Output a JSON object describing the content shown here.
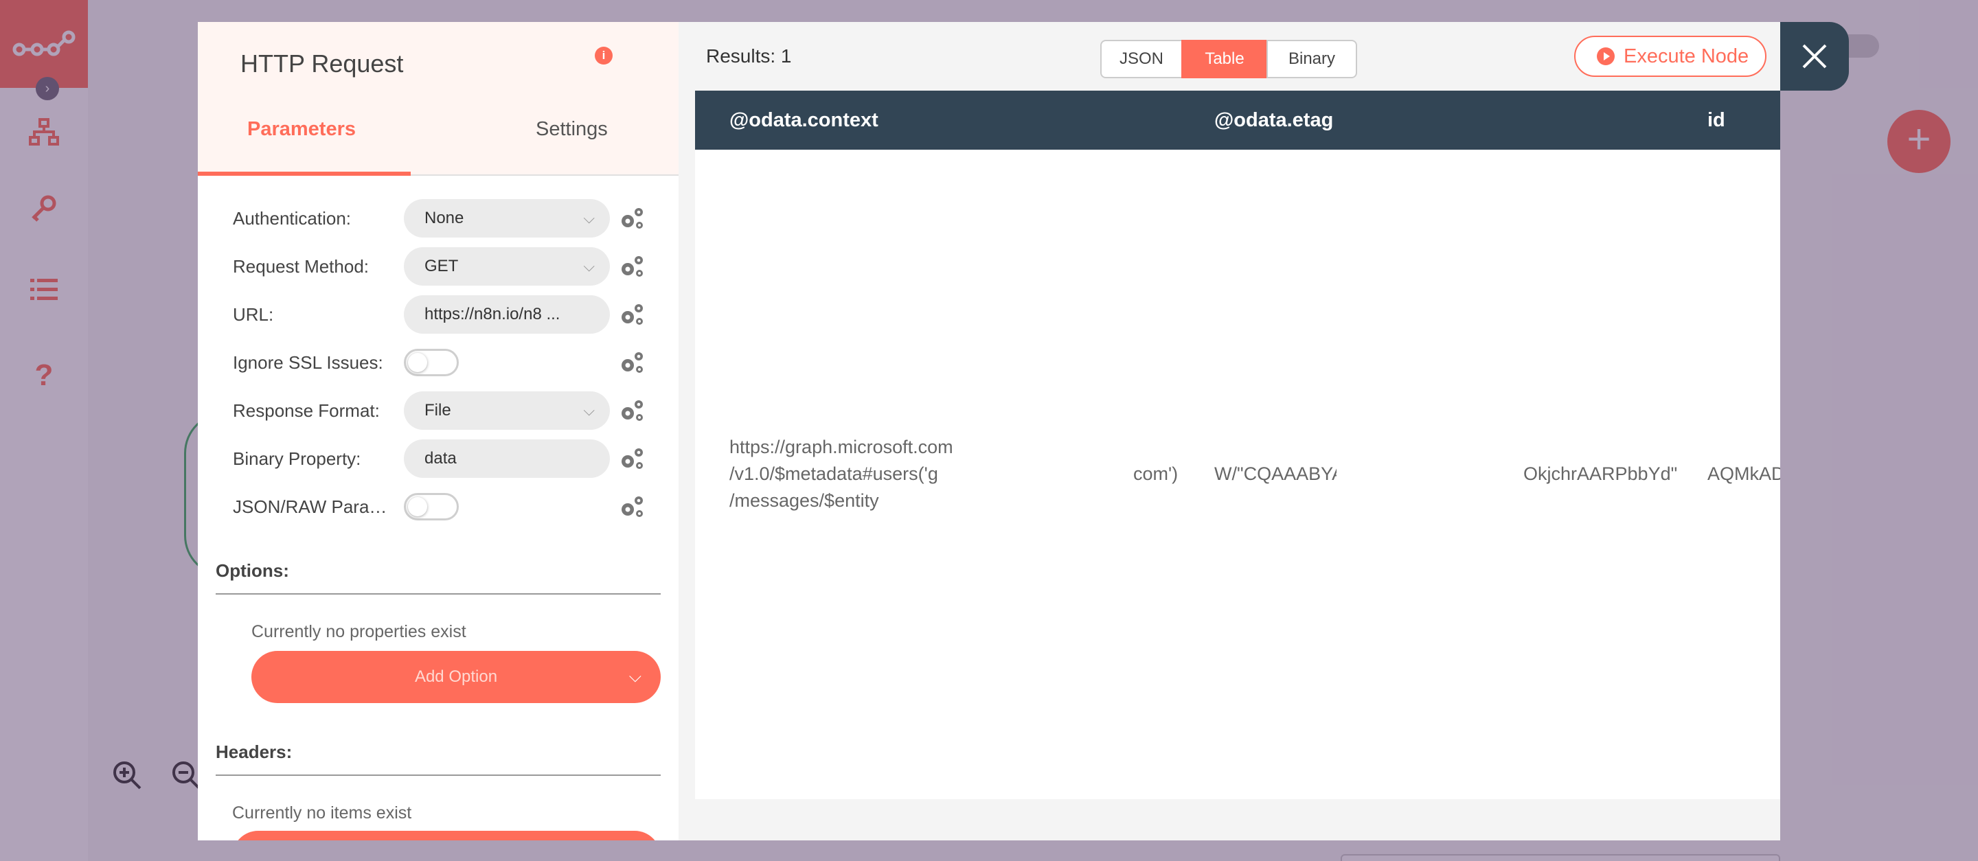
{
  "app": {
    "accent_color": "#ff6d5a",
    "header_color": "#324555"
  },
  "sidebar": {
    "logo_icon": "n8n-logo-icon",
    "expand_icon": "chevron-right-icon",
    "items": [
      {
        "icon": "network-icon"
      },
      {
        "icon": "key-icon"
      },
      {
        "icon": "list-icon"
      },
      {
        "icon": "question-icon"
      }
    ]
  },
  "canvas": {
    "zoom_in_icon": "zoom-in-icon",
    "zoom_out_icon": "zoom-out-icon",
    "add_node_label": "+"
  },
  "node_panel": {
    "title": "HTTP Request",
    "tabs": [
      {
        "label": "Parameters",
        "active": true
      },
      {
        "label": "Settings",
        "active": false
      }
    ],
    "fields": [
      {
        "label": "Authentication:",
        "type": "select",
        "value": "None"
      },
      {
        "label": "Request Method:",
        "type": "select",
        "value": "GET"
      },
      {
        "label": "URL:",
        "type": "text",
        "value": "https://n8n.io/n8 ..."
      },
      {
        "label": "Ignore SSL Issues:",
        "type": "toggle",
        "value": false
      },
      {
        "label": "Response Format:",
        "type": "select",
        "value": "File"
      },
      {
        "label": "Binary Property:",
        "type": "text",
        "value": "data"
      },
      {
        "label": "JSON/RAW Parame...",
        "type": "toggle",
        "value": false
      }
    ],
    "options": {
      "title": "Options:",
      "empty_text": "Currently no properties exist",
      "add_button_label": "Add Option"
    },
    "headers": {
      "title": "Headers:",
      "empty_text": "Currently no items exist"
    }
  },
  "results": {
    "label": "Results: 1",
    "info_icon": "i",
    "view_modes": [
      {
        "label": "JSON",
        "active": false
      },
      {
        "label": "Table",
        "active": true
      },
      {
        "label": "Binary",
        "active": false
      }
    ],
    "execute_label": "Execute Node",
    "columns": [
      "@odata.context",
      "@odata.etag",
      "id"
    ],
    "row": {
      "context": [
        "https://graph.microsoft.com",
        "/v1.0/$metadata#users('g",
        "/messages/$entity"
      ],
      "context_tail": "com')",
      "etag_head": "W/\"CQAAABYA",
      "etag_tail": "OkjchrAARPbbYd\"",
      "id": "AQMkAD"
    }
  }
}
